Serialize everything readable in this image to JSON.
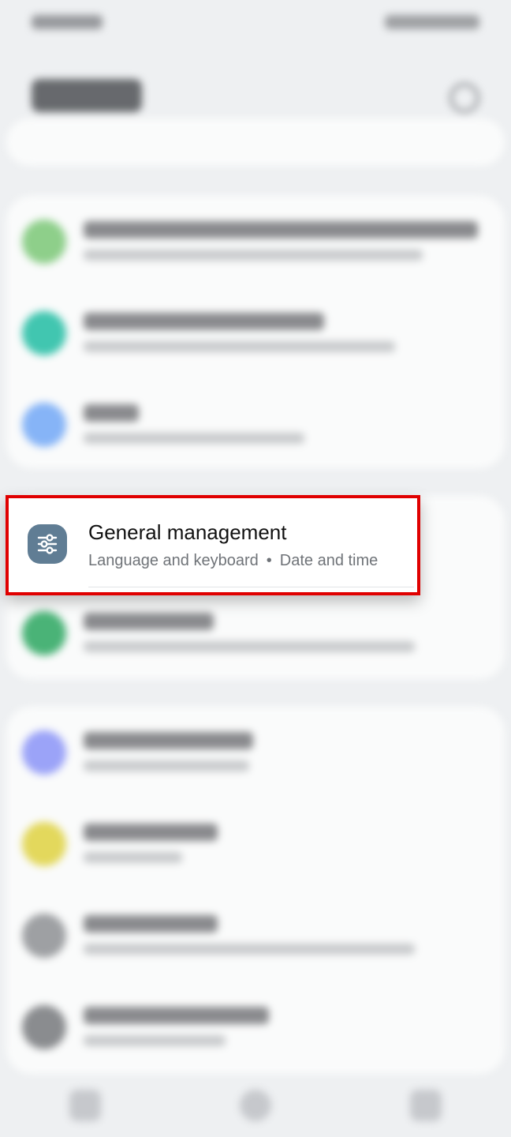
{
  "general_management": {
    "title": "General management",
    "subtitle_items": [
      "Language and keyboard",
      "Date and time"
    ],
    "separator": "•",
    "icon": "sliders-icon"
  },
  "colors": {
    "highlight_border": "#e00000",
    "icon_bg": "#607d94",
    "icon_colors": [
      "#8ecf8a",
      "#41c6b0",
      "#86b4f7",
      "#4ab377",
      "#9ba3f8",
      "#e3d85c",
      "#9ea0a3",
      "#8a8c8f"
    ]
  }
}
